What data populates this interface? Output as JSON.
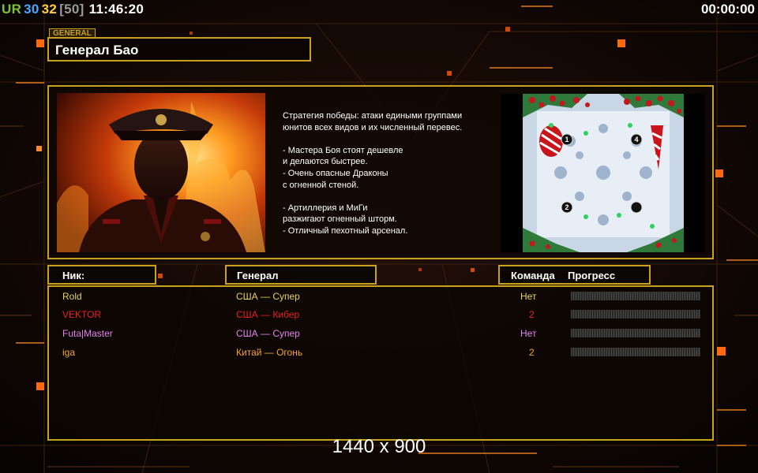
{
  "hud": {
    "ur": "UR",
    "n1": "30",
    "n2": "32",
    "n3": "[50]",
    "clock": "11:46:20",
    "timer": "00:00:00",
    "colors": {
      "ur": "#7ec236",
      "n1": "#4aa8ff",
      "n2": "#ffd23a",
      "n3": "#9a9a9a"
    }
  },
  "general": {
    "tag": "GENERAL",
    "name": "Генерал Бао",
    "description": [
      "Стратегия победы: атаки едиными группами",
      "юнитов всех видов и их численный перевес.",
      "",
      "- Мастера Боя стоят дешевле",
      "и делаются быстрее.",
      "- Очень опасные Драконы",
      "с огненной стеной.",
      "",
      "- Артиллерия и МиГи",
      "разжигают огненный шторм.",
      "- Отличный пехотный арсенал."
    ]
  },
  "map": {
    "start_positions": [
      "1",
      "2",
      "4"
    ]
  },
  "table": {
    "headers": {
      "nick": "Ник:",
      "general": "Генерал",
      "team": "Команда",
      "progress": "Прогресс"
    },
    "rows": [
      {
        "nick": "Rold",
        "general": "США — Супер",
        "team": "Нет",
        "progress": 0,
        "color": "#e6d35a"
      },
      {
        "nick": "VEKTOR",
        "general": "США — Кибер",
        "team": "2",
        "progress": 0,
        "color": "#e8221d"
      },
      {
        "nick": "Futa|Master",
        "general": "США — Супер",
        "team": "Нет",
        "progress": 0,
        "color": "#e082ee"
      },
      {
        "nick": "iga",
        "general": "Китай — Огонь",
        "team": "2",
        "progress": 0,
        "color": "#f5a531"
      }
    ]
  },
  "resolution": "1440 x 900",
  "accent": "#c8a21c"
}
